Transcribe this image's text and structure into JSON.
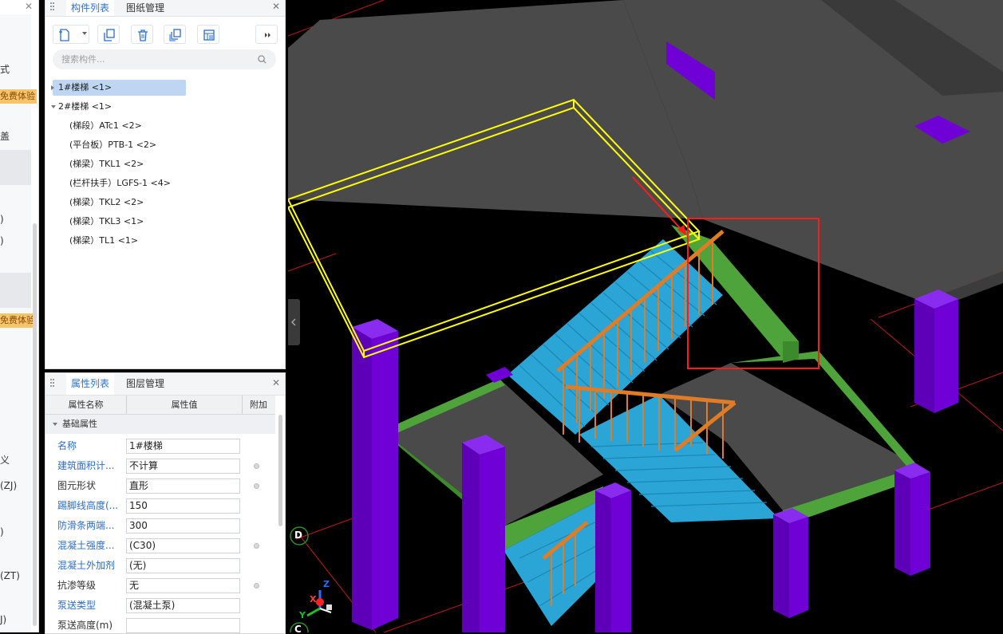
{
  "left_panel": {
    "items": [
      {
        "id": "i1",
        "label": "式"
      },
      {
        "id": "i2",
        "label": "盖"
      },
      {
        "id": "i3",
        "label": ")"
      },
      {
        "id": "i4",
        "label": ")"
      },
      {
        "id": "i5",
        "label": "义"
      },
      {
        "id": "i6",
        "label": "(ZJ)"
      },
      {
        "id": "i7",
        "label": ")"
      },
      {
        "id": "i8",
        "label": "(ZT)"
      },
      {
        "id": "i9",
        "label": "J)"
      }
    ],
    "badges": [
      "免费体验",
      "免费体验"
    ]
  },
  "component_panel": {
    "tabs": [
      "构件列表",
      "图纸管理"
    ],
    "close_label": "✕",
    "search_placeholder": "搜索构件...",
    "tree": [
      {
        "label": "1#楼梯  <1>",
        "level": 0,
        "expanded": false,
        "selected": true
      },
      {
        "label": "2#楼梯  <1>",
        "level": 0,
        "expanded": true,
        "selected": false
      },
      {
        "label": "(梯段）ATc1  <2>",
        "level": 1
      },
      {
        "label": "(平台板）PTB-1  <2>",
        "level": 1
      },
      {
        "label": "(梯梁）TKL1  <2>",
        "level": 1
      },
      {
        "label": "(栏杆扶手）LGFS-1  <4>",
        "level": 1
      },
      {
        "label": "(梯梁）TKL2  <2>",
        "level": 1
      },
      {
        "label": "(梯梁）TKL3  <1>",
        "level": 1
      },
      {
        "label": "(梯梁）TL1  <1>",
        "level": 1
      }
    ]
  },
  "property_panel": {
    "tabs": [
      "属性列表",
      "图层管理"
    ],
    "close_label": "✕",
    "columns": [
      "属性名称",
      "属性值",
      "附加"
    ],
    "group": "基础属性",
    "rows": [
      {
        "name": "名称",
        "value": "1#楼梯",
        "blue": true,
        "has_checkbox": false
      },
      {
        "name": "建筑面积计...",
        "value": "不计算",
        "blue": true,
        "has_checkbox": true
      },
      {
        "name": "图元形状",
        "value": "直形",
        "blue": false,
        "has_checkbox": true
      },
      {
        "name": "踢脚线高度(...",
        "value": "150",
        "blue": true,
        "has_checkbox": false
      },
      {
        "name": "防滑条两端...",
        "value": "300",
        "blue": true,
        "has_checkbox": false
      },
      {
        "name": "混凝土强度...",
        "value": "(C30)",
        "blue": true,
        "has_checkbox": true
      },
      {
        "name": "混凝土外加剂",
        "value": "(无)",
        "blue": true,
        "has_checkbox": false
      },
      {
        "name": "抗渗等级",
        "value": "无",
        "blue": false,
        "has_checkbox": true
      },
      {
        "name": "泵送类型",
        "value": "(混凝土泵)",
        "blue": true,
        "has_checkbox": false
      },
      {
        "name": "泵送高度(m)",
        "value": "",
        "blue": false,
        "has_checkbox": false
      }
    ]
  },
  "viewport": {
    "axis_labels": [
      "D",
      "C"
    ],
    "gizmo_labels": [
      "X",
      "Y",
      "Z"
    ],
    "colors": {
      "slab": "#4a4a4a",
      "column": "#6f00d6",
      "beam": "#4ea43a",
      "stair": "#2aa5d6",
      "railing": "#e07b26",
      "highlight": "#ffff00",
      "annotation": "#ff2020"
    }
  }
}
